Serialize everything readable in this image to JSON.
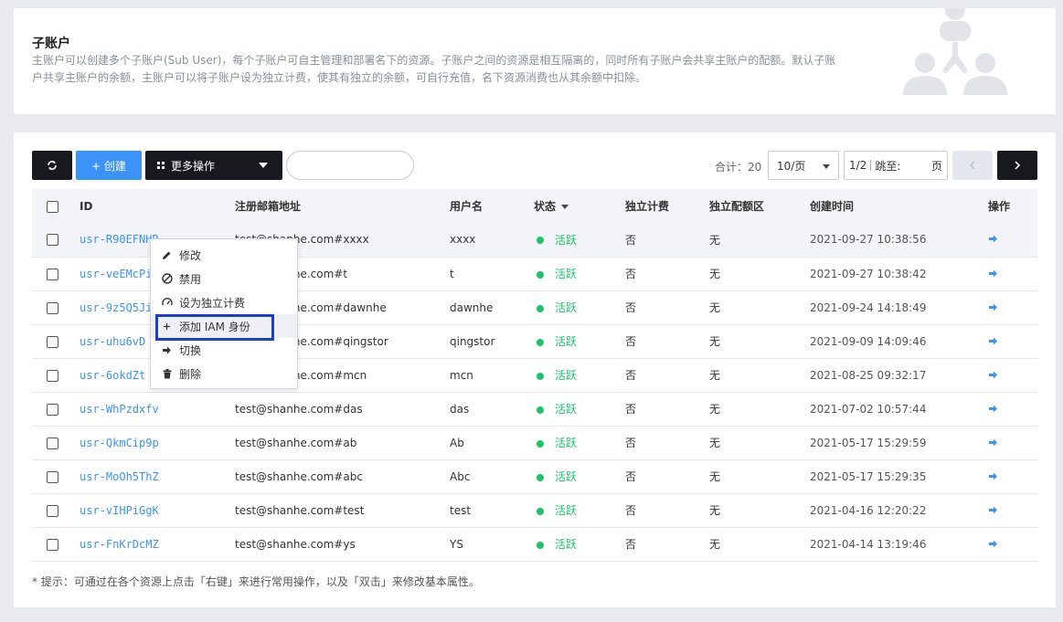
{
  "header": {
    "title": "子账户",
    "description": "主账户可以创建多个子账户(Sub User)，每个子账户可自主管理和部署名下的资源。子账户之间的资源是相互隔离的，同时所有子账户会共享主账户的配额。默认子账户共享主账户的余额，主账户可以将子账户设为独立计费，使其有独立的余额，可自行充值，名下资源消费也从其余额中扣除。"
  },
  "toolbar": {
    "refresh_icon": "refresh-icon",
    "create_label": "+ 创建",
    "more_label": "更多操作",
    "search_placeholder": ""
  },
  "pagination": {
    "total": "合计：20",
    "page_size": "10/页",
    "page_indicator": "1/2",
    "jump_label": "跳至:",
    "page_unit": "页"
  },
  "table": {
    "headers": [
      "ID",
      "注册邮箱地址",
      "用户名",
      "状态",
      "独立计费",
      "独立配额区",
      "创建时间",
      "操作"
    ],
    "rows": [
      {
        "id": "usr-R90EFNHR",
        "email": "test@shanhe.com#xxxx",
        "username": "xxxx",
        "state": "活跃",
        "independent_billing": "否",
        "independent_quota": "无",
        "created": "2021-09-27 10:38:56"
      },
      {
        "id": "usr-veEMcPi",
        "email": "test@shanhe.com#t",
        "username": "t",
        "state": "活跃",
        "independent_billing": "否",
        "independent_quota": "无",
        "created": "2021-09-27 10:38:42"
      },
      {
        "id": "usr-9z5Q5Ji",
        "email": "test@shanhe.com#dawnhe",
        "username": "dawnhe",
        "state": "活跃",
        "independent_billing": "否",
        "independent_quota": "无",
        "created": "2021-09-24 14:18:49"
      },
      {
        "id": "usr-uhu6vD",
        "email": "test@shanhe.com#qingstor",
        "username": "qingstor",
        "state": "活跃",
        "independent_billing": "否",
        "independent_quota": "无",
        "created": "2021-09-09 14:09:46"
      },
      {
        "id": "usr-6okdZt",
        "email": "test@shanhe.com#mcn",
        "username": "mcn",
        "state": "活跃",
        "independent_billing": "否",
        "independent_quota": "无",
        "created": "2021-08-25 09:32:17"
      },
      {
        "id": "usr-WhPzdxfv",
        "email": "test@shanhe.com#das",
        "username": "das",
        "state": "活跃",
        "independent_billing": "否",
        "independent_quota": "无",
        "created": "2021-07-02 10:57:44"
      },
      {
        "id": "usr-QkmCip9p",
        "email": "test@shanhe.com#ab",
        "username": "Ab",
        "state": "活跃",
        "independent_billing": "否",
        "independent_quota": "无",
        "created": "2021-05-17 15:29:59"
      },
      {
        "id": "usr-MoOh5ThZ",
        "email": "test@shanhe.com#abc",
        "username": "Abc",
        "state": "活跃",
        "independent_billing": "否",
        "independent_quota": "无",
        "created": "2021-05-17 15:29:35"
      },
      {
        "id": "usr-vIHPiGgK",
        "email": "test@shanhe.com#test",
        "username": "test",
        "state": "活跃",
        "independent_billing": "否",
        "independent_quota": "无",
        "created": "2021-04-16 12:20:22"
      },
      {
        "id": "usr-FnKrDcMZ",
        "email": "test@shanhe.com#ys",
        "username": "YS",
        "state": "活跃",
        "independent_billing": "否",
        "independent_quota": "无",
        "created": "2021-04-14 13:19:46"
      }
    ]
  },
  "context_menu": {
    "items": [
      {
        "label": "修改",
        "icon": "pencil-icon"
      },
      {
        "label": "禁用",
        "icon": "ban-icon"
      },
      {
        "label": "设为独立计费",
        "icon": "gauge-icon"
      },
      {
        "label": "添加 IAM 身份",
        "icon": "plus-icon"
      },
      {
        "label": "切换",
        "icon": "arrow-right-icon"
      },
      {
        "label": "删除",
        "icon": "trash-icon"
      }
    ]
  },
  "tip": "* 提示：可通过在各个资源上点击「右键」来进行常用操作，以及「双击」来修改基本属性。",
  "colors": {
    "accent": "#3b93f7",
    "active_green": "#1fc26b",
    "dark_button": "#17191e",
    "highlight_border": "#1c3fc9"
  }
}
